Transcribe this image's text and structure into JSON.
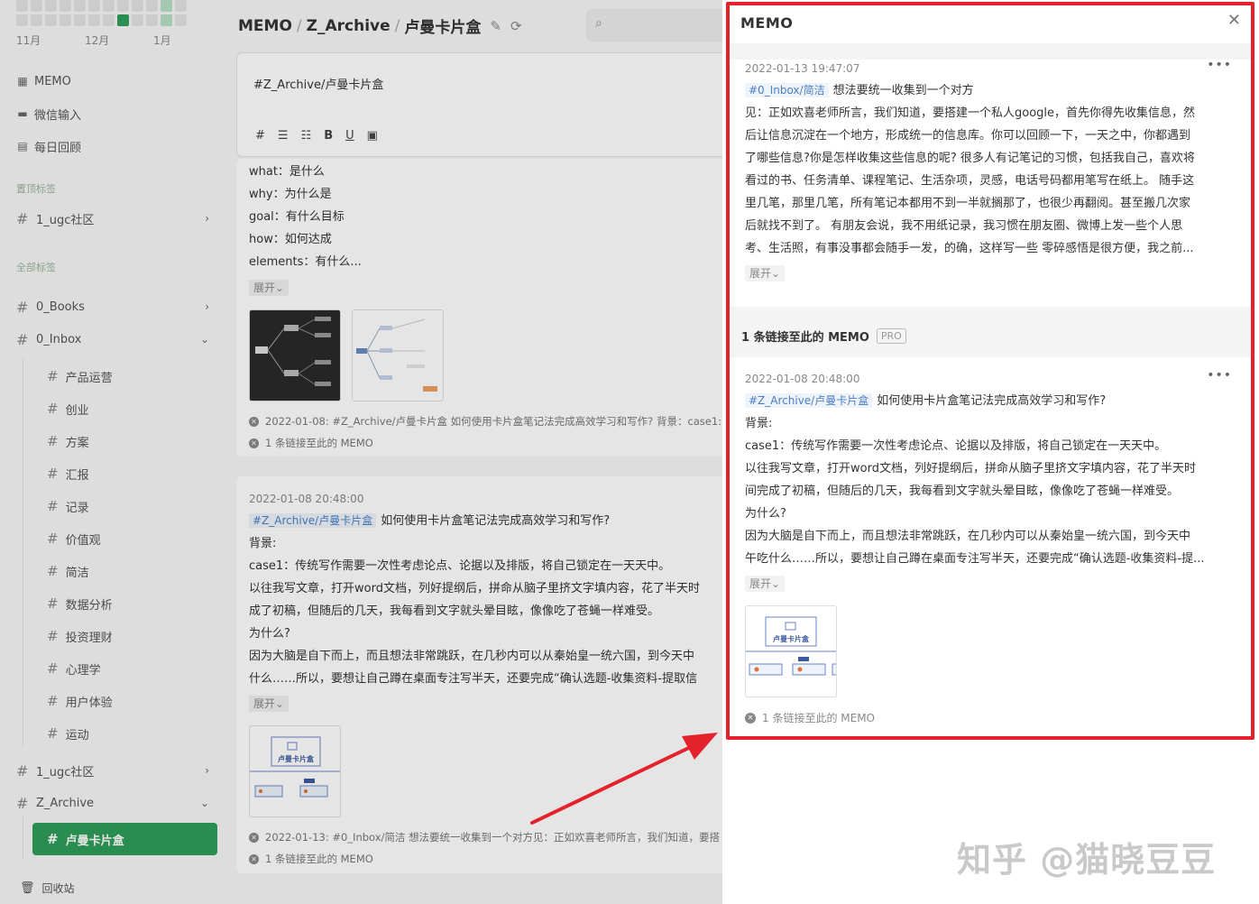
{
  "calendar": {
    "months": [
      "11月",
      "12月",
      "1月"
    ]
  },
  "sidebar": {
    "nav": [
      {
        "label": "MEMO",
        "icon": "grid-icon"
      },
      {
        "label": "微信输入",
        "icon": "chat-icon"
      },
      {
        "label": "每日回顾",
        "icon": "calendar-icon"
      }
    ],
    "pinned_label": "置顶标签",
    "pinned": [
      {
        "label": "1_ugc社区"
      }
    ],
    "all_label": "全部标签",
    "tags": [
      {
        "label": "0_Books"
      },
      {
        "label": "0_Inbox"
      }
    ],
    "inbox_children": [
      "产品运营",
      "创业",
      "方案",
      "汇报",
      "记录",
      "价值观",
      "简洁",
      "数据分析",
      "投资理财",
      "心理学",
      "用户体验",
      "运动"
    ],
    "tags2": [
      {
        "label": "1_ugc社区"
      },
      {
        "label": "Z_Archive"
      }
    ],
    "active_tag": "卢曼卡片盒",
    "trash": "回收站"
  },
  "main": {
    "breadcrumb": [
      "MEMO",
      "Z_Archive",
      "卢曼卡片盒"
    ],
    "editor_text": "#Z_Archive/卢曼卡片盒",
    "toolbar": [
      "#",
      "☰",
      "☷",
      "B",
      "U",
      "▣"
    ],
    "card1_lines": [
      "what：是什么",
      "why：为什么是",
      "goal：有什么目标",
      "how：如何达成",
      "elements：有什么..."
    ],
    "expand_label": "展开",
    "card1_ref1": "2022-01-08: #Z_Archive/卢曼卡片盒 如何使用卡片盒笔记法完成高效学习和写作? 背景：case1:",
    "card1_ref2": "1 条链接至此的 MEMO",
    "card2_time": "2022-01-08 20:48:00",
    "card2_tag": "#Z_Archive/卢曼卡片盒",
    "card2_title": "如何使用卡片盒笔记法完成高效学习和写作?",
    "card2_lines": [
      "背景:",
      "case1：传统写作需要一次性考虑论点、论据以及排版，将自己锁定在一天天中。",
      "以往我写文章，打开word文档，列好提纲后，拼命从脑子里挤文字填内容，花了半天时",
      "成了初稿，但随后的几天，我每看到文字就头晕目眩，像像吃了苍蝇一样难受。",
      "为什么?",
      "因为大脑是自下而上，而且想法非常跳跃，在几秒内可以从秦始皇一统六国，到今天中",
      "什么……所以，要想让自己蹲在桌面专注写半天，还要完成“确认选题-收集资料-提取信"
    ],
    "card2_ref1": "2022-01-13: #0_Inbox/简洁 想法要统一收集到一个对方见：正如欢喜老师所言，我们知道，要搭",
    "card2_ref2": "1 条链接至此的 MEMO",
    "thumb_title": "卢曼卡片盒"
  },
  "drawer": {
    "title": "MEMO",
    "memo1": {
      "time": "2022-01-13 19:47:07",
      "tag": "#0_Inbox/简洁",
      "title": "想法要统一收集到一个对方",
      "lines": [
        "见：正如欢喜老师所言，我们知道，要搭建一个私人google，首先你得先收集信息，然",
        "后让信息沉淀在一个地方，形成统一的信息库。你可以回顾一下，一天之中，你都遇到",
        "了哪些信息?你是怎样收集这些信息的呢? 很多人有记笔记的习惯，包括我自己，喜欢将",
        "看过的书、任务清单、课程笔记、生活杂项，灵感，电话号码都用笔写在纸上。 随手这",
        "里几笔，那里几笔，所有笔记本都用不到一半就搁那了，也很少再翻阅。甚至搬几次家",
        "后就找不到了。 有朋友会说，我不用纸记录，我习惯在朋友圈、微博上发一些个人思",
        "考、生活照，有事没事都会随手一发，的确，这样写一些 零碎感悟是很方便，我之前..."
      ],
      "expand": "展开"
    },
    "links_title": "1 条链接至此的 MEMO",
    "pro_badge": "PRO",
    "memo2": {
      "time": "2022-01-08 20:48:00",
      "tag": "#Z_Archive/卢曼卡片盒",
      "title": "如何使用卡片盒笔记法完成高效学习和写作?",
      "lines": [
        "背景:",
        "case1：传统写作需要一次性考虑论点、论据以及排版，将自己锁定在一天天中。",
        "以往我写文章，打开word文档，列好提纲后，拼命从脑子里挤文字填内容，花了半天时",
        "间完成了初稿，但随后的几天，我每看到文字就头晕目眩，像像吃了苍蝇一样难受。",
        "为什么?",
        "因为大脑是自下而上，而且想法非常跳跃，在几秒内可以从秦始皇一统六国，到今天中",
        "午吃什么……所以，要想让自己蹲在桌面专注写半天，还要完成“确认选题-收集资料-提..."
      ],
      "expand": "展开",
      "thumb_title": "卢曼卡片盒",
      "ref": "1 条链接至此的 MEMO"
    },
    "watermark": "知乎 @猫晓豆豆"
  },
  "colors": {
    "accent": "#2f9e5a",
    "highlight": "#e3222b",
    "tag": "#4a7fc4"
  }
}
